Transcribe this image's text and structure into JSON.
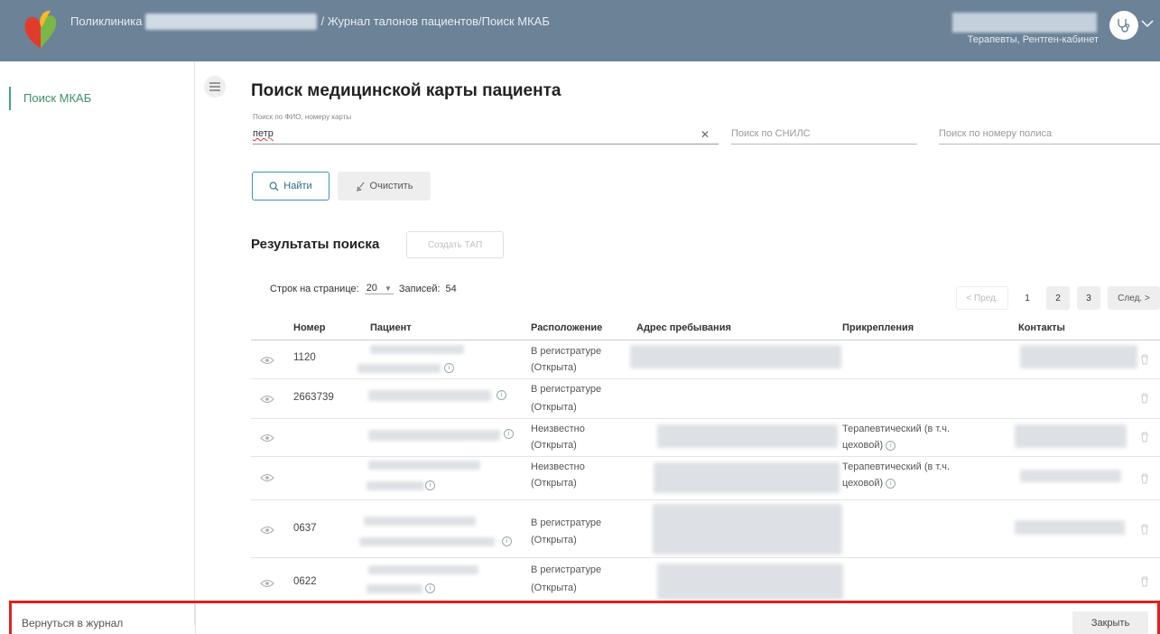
{
  "header": {
    "app_name": "Поликлиника",
    "breadcrumb": "/ Журнал талонов пациентов/Поиск МКАБ",
    "user_role": "Терапевты, Рентген-кабинет"
  },
  "sidebar": {
    "items": [
      {
        "label": "Поиск МКАБ"
      }
    ]
  },
  "main": {
    "title": "Поиск медицинской карты пациента",
    "search": {
      "fio_label": "Поиск по ФИО, номеру карты",
      "fio_value": "петр",
      "snils_placeholder": "Поиск по СНИЛС",
      "polis_placeholder": "Поиск по номеру полиса"
    },
    "buttons": {
      "find": "Найти",
      "clear": "Очистить"
    },
    "results": {
      "title": "Результаты поиска",
      "create_tap": "Создать ТАП",
      "rows_label": "Строк на странице:",
      "rows_value": "20",
      "records_label": "Записей:",
      "records_value": "54"
    },
    "pager": {
      "prev": "< Пред.",
      "pages": [
        "1",
        "2",
        "3"
      ],
      "next": "След. >"
    },
    "table": {
      "columns": [
        "Номер",
        "Пациент",
        "Расположение",
        "Адрес пребывания",
        "Прикрепления",
        "Контакты"
      ],
      "rows": [
        {
          "number": "1120",
          "location": "В регистратуре",
          "status": "(Открыта)",
          "attach_1": "",
          "attach_2": ""
        },
        {
          "number": "2663739",
          "location": "В регистратуре",
          "status": "(Открыта)",
          "attach_1": "",
          "attach_2": ""
        },
        {
          "number": "",
          "location": "Неизвестно",
          "status": "(Открыта)",
          "attach_1": "Терапевтический (в т.ч.",
          "attach_2": "цеховой)"
        },
        {
          "number": "",
          "location": "Неизвестно",
          "status": "(Открыта)",
          "attach_1": "Терапевтический (в т.ч.",
          "attach_2": "цеховой)"
        },
        {
          "number": "0637",
          "location": "В регистратуре",
          "status": "(Открыта)",
          "attach_1": "",
          "attach_2": ""
        },
        {
          "number": "0622",
          "location": "В регистратуре",
          "status": "(Открыта)",
          "attach_1": "",
          "attach_2": ""
        }
      ]
    }
  },
  "footer": {
    "back_label": "Вернуться в журнал",
    "close_label": "Закрыть"
  },
  "colors": {
    "header_bg": "#6b8297",
    "accent_green": "#47a17a",
    "highlight_red": "#e02020"
  }
}
